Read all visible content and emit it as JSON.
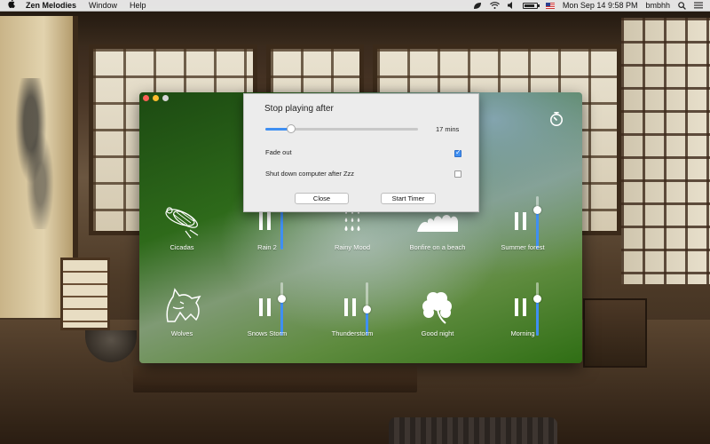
{
  "menubar": {
    "app_name": "Zen Melodies",
    "items": [
      "Window",
      "Help"
    ],
    "clock": "Mon Sep 14  9:58 PM",
    "user": "bmbhh",
    "battery_level": 0.85
  },
  "app": {
    "timer_icon": "timer-icon",
    "accent": "#3f8ff2",
    "tiles": [
      {
        "name": "cicadas",
        "label": "Cicadas",
        "state": "stopped",
        "icon": "cicada-icon"
      },
      {
        "name": "rain-2",
        "label": "Rain 2",
        "state": "playing",
        "volume": 0.9
      },
      {
        "name": "rainy-mood",
        "label": "Rainy Mood",
        "state": "stopped",
        "icon": "rain-drops-icon"
      },
      {
        "name": "bonfire-on-a-beach",
        "label": "Bonfire on a beach",
        "state": "stopped",
        "icon": "waves-icon"
      },
      {
        "name": "summer-forest",
        "label": "Summer forest",
        "state": "playing",
        "volume": 0.75
      },
      {
        "name": "wolves",
        "label": "Wolves",
        "state": "stopped",
        "icon": "wolf-icon"
      },
      {
        "name": "snows-storm",
        "label": "Snows Storm",
        "state": "playing",
        "volume": 0.7
      },
      {
        "name": "thunderstorm",
        "label": "Thunderstorm",
        "state": "playing",
        "volume": 0.5
      },
      {
        "name": "good-night",
        "label": "Good night",
        "state": "stopped",
        "icon": "clover-icon"
      },
      {
        "name": "morning",
        "label": "Morning",
        "state": "playing",
        "volume": 0.7
      }
    ]
  },
  "timer_popover": {
    "title": "Stop playing after",
    "minutes_label": "17 mins",
    "slider_fraction": 0.17,
    "fade_out_label": "Fade out",
    "fade_out_checked": true,
    "shutdown_label": "Shut down computer after Zzz",
    "shutdown_checked": false,
    "close_label": "Close",
    "start_label": "Start Timer"
  }
}
